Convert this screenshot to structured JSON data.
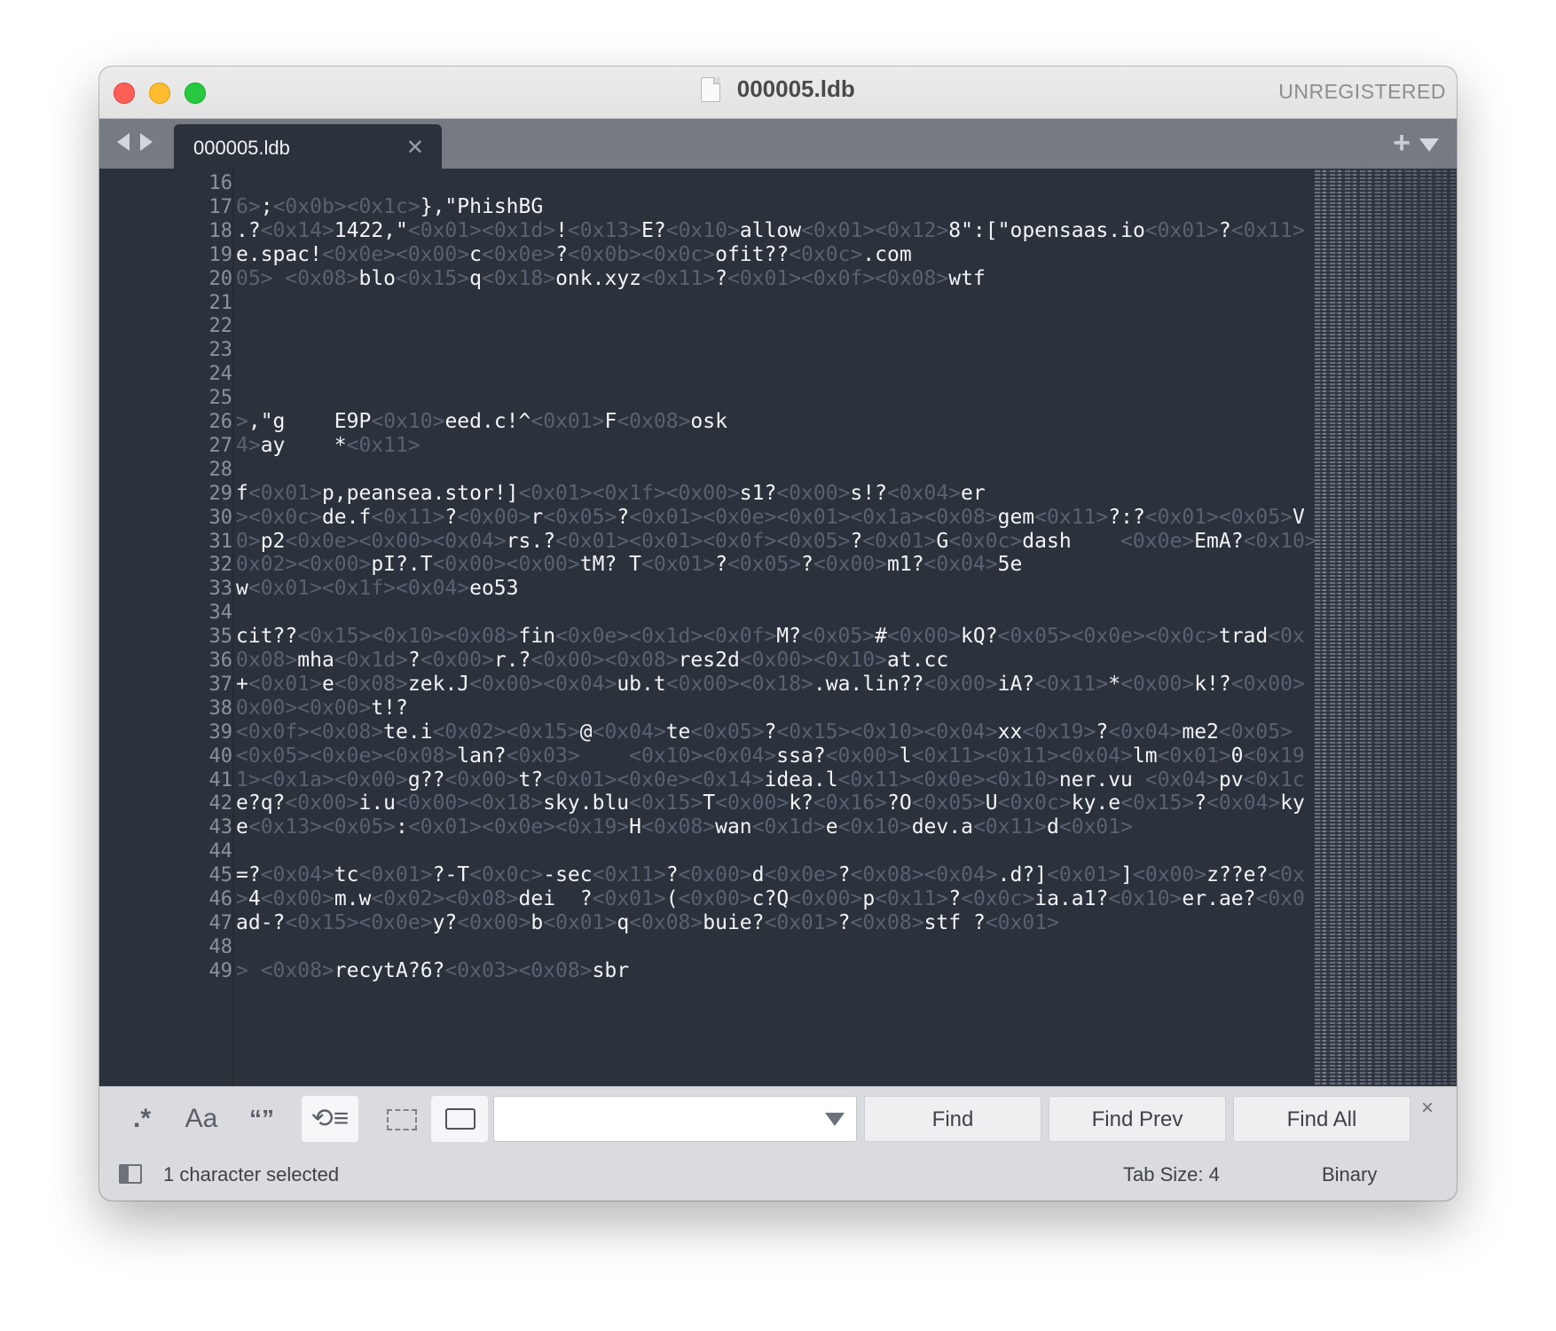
{
  "window": {
    "title": "000005.ldb",
    "unregistered": "UNREGISTERED",
    "traffic_lights": [
      "close",
      "minimize",
      "zoom"
    ]
  },
  "tabs": [
    {
      "label": "000005.ldb",
      "active": true
    }
  ],
  "editor": {
    "colors": {
      "background": "#2c323b",
      "text": "#f2f4f7",
      "control_chars": "#596270",
      "line_numbers": "#8a929c"
    },
    "first_line_number": 16,
    "lines": [
      [],
      [
        [
          "c",
          "6>"
        ],
        [
          "t",
          ";"
        ],
        [
          "c",
          "<0x0b><0x1c>"
        ],
        [
          "t",
          "},\"PhishBG"
        ]
      ],
      [
        [
          "t",
          ".?"
        ],
        [
          "c",
          "<0x14>"
        ],
        [
          "t",
          "1422,\""
        ],
        [
          "c",
          "<0x01><0x1d>"
        ],
        [
          "t",
          "!"
        ],
        [
          "c",
          "<0x13>"
        ],
        [
          "t",
          "E?"
        ],
        [
          "c",
          "<0x10>"
        ],
        [
          "t",
          "allow"
        ],
        [
          "c",
          "<0x01><0x12>"
        ],
        [
          "t",
          "8\":[\"opensaas.io"
        ],
        [
          "c",
          "<0x01>"
        ],
        [
          "t",
          "?"
        ],
        [
          "c",
          "<0x11>"
        ]
      ],
      [
        [
          "t",
          "e.spac!"
        ],
        [
          "c",
          "<0x0e><0x00>"
        ],
        [
          "t",
          "c"
        ],
        [
          "c",
          "<0x0e>"
        ],
        [
          "t",
          "?"
        ],
        [
          "c",
          "<0x0b><0x0c>"
        ],
        [
          "t",
          "ofit??"
        ],
        [
          "c",
          "<0x0c>"
        ],
        [
          "t",
          ".com"
        ]
      ],
      [
        [
          "c",
          "05> <0x08>"
        ],
        [
          "t",
          "blo"
        ],
        [
          "c",
          "<0x15>"
        ],
        [
          "t",
          "q"
        ],
        [
          "c",
          "<0x18>"
        ],
        [
          "t",
          "onk.xyz"
        ],
        [
          "c",
          "<0x11>"
        ],
        [
          "t",
          "?"
        ],
        [
          "c",
          "<0x01><0x0f><0x08>"
        ],
        [
          "t",
          "wtf"
        ]
      ],
      [],
      [],
      [],
      [],
      [],
      [
        [
          "c",
          ">"
        ],
        [
          "t",
          ",\"g    E9P"
        ],
        [
          "c",
          "<0x10>"
        ],
        [
          "t",
          "eed.c!^"
        ],
        [
          "c",
          "<0x01>"
        ],
        [
          "t",
          "F"
        ],
        [
          "c",
          "<0x08>"
        ],
        [
          "t",
          "osk"
        ]
      ],
      [
        [
          "c",
          "4>"
        ],
        [
          "t",
          "ay    *"
        ],
        [
          "c",
          "<0x11>"
        ]
      ],
      [],
      [
        [
          "t",
          "f"
        ],
        [
          "c",
          "<0x01>"
        ],
        [
          "t",
          "p,peansea.stor!]"
        ],
        [
          "c",
          "<0x01><0x1f><0x00>"
        ],
        [
          "t",
          "s1?"
        ],
        [
          "c",
          "<0x00>"
        ],
        [
          "t",
          "s!?"
        ],
        [
          "c",
          "<0x04>"
        ],
        [
          "t",
          "er"
        ]
      ],
      [
        [
          "c",
          "><0x0c>"
        ],
        [
          "t",
          "de.f"
        ],
        [
          "c",
          "<0x11>"
        ],
        [
          "t",
          "?"
        ],
        [
          "c",
          "<0x00>"
        ],
        [
          "t",
          "r"
        ],
        [
          "c",
          "<0x05>"
        ],
        [
          "t",
          "?"
        ],
        [
          "c",
          "<0x01><0x0e><0x01><0x1a><0x08>"
        ],
        [
          "t",
          "gem"
        ],
        [
          "c",
          "<0x11>"
        ],
        [
          "t",
          "?:?"
        ],
        [
          "c",
          "<0x01><0x05>"
        ],
        [
          "t",
          "V"
        ]
      ],
      [
        [
          "c",
          "0>"
        ],
        [
          "t",
          "p2"
        ],
        [
          "c",
          "<0x0e><0x00><0x04>"
        ],
        [
          "t",
          "rs.?"
        ],
        [
          "c",
          "<0x01><0x01><0x0f><0x05>"
        ],
        [
          "t",
          "?"
        ],
        [
          "c",
          "<0x01>"
        ],
        [
          "t",
          "G"
        ],
        [
          "c",
          "<0x0c>"
        ],
        [
          "t",
          "dash    "
        ],
        [
          "c",
          "<0x0e>"
        ],
        [
          "t",
          "EmA?"
        ],
        [
          "c",
          "<0x10>"
        ]
      ],
      [
        [
          "c",
          "0x02><0x00>"
        ],
        [
          "t",
          "pI?.T"
        ],
        [
          "c",
          "<0x00><0x00>"
        ],
        [
          "t",
          "tM? T"
        ],
        [
          "c",
          "<0x01>"
        ],
        [
          "t",
          "?"
        ],
        [
          "c",
          "<0x05>"
        ],
        [
          "t",
          "?"
        ],
        [
          "c",
          "<0x00>"
        ],
        [
          "t",
          "m1?"
        ],
        [
          "c",
          "<0x04>"
        ],
        [
          "t",
          "5e"
        ]
      ],
      [
        [
          "t",
          "w"
        ],
        [
          "c",
          "<0x01><0x1f><0x04>"
        ],
        [
          "t",
          "eo53"
        ]
      ],
      [],
      [
        [
          "t",
          "cit??"
        ],
        [
          "c",
          "<0x15><0x10><0x08>"
        ],
        [
          "t",
          "fin"
        ],
        [
          "c",
          "<0x0e><0x1d><0x0f>"
        ],
        [
          "t",
          "M?"
        ],
        [
          "c",
          "<0x05>"
        ],
        [
          "t",
          "#"
        ],
        [
          "c",
          "<0x00>"
        ],
        [
          "t",
          "kQ?"
        ],
        [
          "c",
          "<0x05><0x0e><0x0c>"
        ],
        [
          "t",
          "trad"
        ],
        [
          "c",
          "<0x"
        ]
      ],
      [
        [
          "c",
          "0x08>"
        ],
        [
          "t",
          "mha"
        ],
        [
          "c",
          "<0x1d>"
        ],
        [
          "t",
          "?"
        ],
        [
          "c",
          "<0x00>"
        ],
        [
          "t",
          "r.?"
        ],
        [
          "c",
          "<0x00><0x08>"
        ],
        [
          "t",
          "res2d"
        ],
        [
          "c",
          "<0x00><0x10>"
        ],
        [
          "t",
          "at.cc"
        ]
      ],
      [
        [
          "t",
          "+"
        ],
        [
          "c",
          "<0x01>"
        ],
        [
          "t",
          "e"
        ],
        [
          "c",
          "<0x08>"
        ],
        [
          "t",
          "zek.J"
        ],
        [
          "c",
          "<0x00><0x04>"
        ],
        [
          "t",
          "ub.t"
        ],
        [
          "c",
          "<0x00><0x18>"
        ],
        [
          "t",
          ".wa.lin??"
        ],
        [
          "c",
          "<0x00>"
        ],
        [
          "t",
          "iA?"
        ],
        [
          "c",
          "<0x11>"
        ],
        [
          "t",
          "*"
        ],
        [
          "c",
          "<0x00>"
        ],
        [
          "t",
          "k!?"
        ],
        [
          "c",
          "<0x00>"
        ]
      ],
      [
        [
          "c",
          "0x00><0x00>"
        ],
        [
          "t",
          "t!?"
        ]
      ],
      [
        [
          "c",
          "<0x0f><0x08>"
        ],
        [
          "t",
          "te.i"
        ],
        [
          "c",
          "<0x02><0x15>"
        ],
        [
          "t",
          "@"
        ],
        [
          "c",
          "<0x04>"
        ],
        [
          "t",
          "te"
        ],
        [
          "c",
          "<0x05>"
        ],
        [
          "t",
          "?"
        ],
        [
          "c",
          "<0x15><0x10><0x04>"
        ],
        [
          "t",
          "xx"
        ],
        [
          "c",
          "<0x19>"
        ],
        [
          "t",
          "?"
        ],
        [
          "c",
          "<0x04>"
        ],
        [
          "t",
          "me2"
        ],
        [
          "c",
          "<0x05>"
        ]
      ],
      [
        [
          "c",
          "<0x05><0x0e><0x08>"
        ],
        [
          "t",
          "lan?"
        ],
        [
          "c",
          "<0x03>    <0x10><0x04>"
        ],
        [
          "t",
          "ssa?"
        ],
        [
          "c",
          "<0x00>"
        ],
        [
          "t",
          "l"
        ],
        [
          "c",
          "<0x11><0x11><0x04>"
        ],
        [
          "t",
          "lm"
        ],
        [
          "c",
          "<0x01>"
        ],
        [
          "t",
          "0"
        ],
        [
          "c",
          "<0x19"
        ]
      ],
      [
        [
          "c",
          "1><0x1a><0x00>"
        ],
        [
          "t",
          "g??"
        ],
        [
          "c",
          "<0x00>"
        ],
        [
          "t",
          "t?"
        ],
        [
          "c",
          "<0x01><0x0e><0x14>"
        ],
        [
          "t",
          "idea.l"
        ],
        [
          "c",
          "<0x11><0x0e><0x10>"
        ],
        [
          "t",
          "ner.vu "
        ],
        [
          "c",
          "<0x04>"
        ],
        [
          "t",
          "pv"
        ],
        [
          "c",
          "<0x1c"
        ]
      ],
      [
        [
          "t",
          "e?q?"
        ],
        [
          "c",
          "<0x00>"
        ],
        [
          "t",
          "i.u"
        ],
        [
          "c",
          "<0x00><0x18>"
        ],
        [
          "t",
          "sky.blu"
        ],
        [
          "c",
          "<0x15>"
        ],
        [
          "t",
          "T"
        ],
        [
          "c",
          "<0x00>"
        ],
        [
          "t",
          "k?"
        ],
        [
          "c",
          "<0x16>"
        ],
        [
          "t",
          "?O"
        ],
        [
          "c",
          "<0x05>"
        ],
        [
          "t",
          "U"
        ],
        [
          "c",
          "<0x0c>"
        ],
        [
          "t",
          "ky.e"
        ],
        [
          "c",
          "<0x15>"
        ],
        [
          "t",
          "?"
        ],
        [
          "c",
          "<0x04>"
        ],
        [
          "t",
          "ky"
        ]
      ],
      [
        [
          "t",
          "e"
        ],
        [
          "c",
          "<0x13><0x05>"
        ],
        [
          "t",
          ":"
        ],
        [
          "c",
          "<0x01><0x0e><0x19>"
        ],
        [
          "t",
          "H"
        ],
        [
          "c",
          "<0x08>"
        ],
        [
          "t",
          "wan"
        ],
        [
          "c",
          "<0x1d>"
        ],
        [
          "t",
          "e"
        ],
        [
          "c",
          "<0x10>"
        ],
        [
          "t",
          "dev.a"
        ],
        [
          "c",
          "<0x11>"
        ],
        [
          "t",
          "d"
        ],
        [
          "c",
          "<0x01>"
        ]
      ],
      [],
      [
        [
          "t",
          "=?"
        ],
        [
          "c",
          "<0x04>"
        ],
        [
          "t",
          "tc"
        ],
        [
          "c",
          "<0x01>"
        ],
        [
          "t",
          "?-T"
        ],
        [
          "c",
          "<0x0c>"
        ],
        [
          "t",
          "-sec"
        ],
        [
          "c",
          "<0x11>"
        ],
        [
          "t",
          "?"
        ],
        [
          "c",
          "<0x00>"
        ],
        [
          "t",
          "d"
        ],
        [
          "c",
          "<0x0e>"
        ],
        [
          "t",
          "?"
        ],
        [
          "c",
          "<0x08><0x04>"
        ],
        [
          "t",
          ".d?]"
        ],
        [
          "c",
          "<0x01>"
        ],
        [
          "t",
          "]"
        ],
        [
          "c",
          "<0x00>"
        ],
        [
          "t",
          "z??e?"
        ],
        [
          "c",
          "<0x"
        ]
      ],
      [
        [
          "c",
          ">"
        ],
        [
          "t",
          "4"
        ],
        [
          "c",
          "<0x00>"
        ],
        [
          "t",
          "m.w"
        ],
        [
          "c",
          "<0x02><0x08>"
        ],
        [
          "t",
          "dei  ?"
        ],
        [
          "c",
          "<0x01>"
        ],
        [
          "t",
          "("
        ],
        [
          "c",
          "<0x00>"
        ],
        [
          "t",
          "c?Q"
        ],
        [
          "c",
          "<0x00>"
        ],
        [
          "t",
          "p"
        ],
        [
          "c",
          "<0x11>"
        ],
        [
          "t",
          "?"
        ],
        [
          "c",
          "<0x0c>"
        ],
        [
          "t",
          "ia.a1?"
        ],
        [
          "c",
          "<0x10>"
        ],
        [
          "t",
          "er.ae?"
        ],
        [
          "c",
          "<0x0"
        ]
      ],
      [
        [
          "t",
          "ad-?"
        ],
        [
          "c",
          "<0x15><0x0e>"
        ],
        [
          "t",
          "y?"
        ],
        [
          "c",
          "<0x00>"
        ],
        [
          "t",
          "b"
        ],
        [
          "c",
          "<0x01>"
        ],
        [
          "t",
          "q"
        ],
        [
          "c",
          "<0x08>"
        ],
        [
          "t",
          "buie?"
        ],
        [
          "c",
          "<0x01>"
        ],
        [
          "t",
          "?"
        ],
        [
          "c",
          "<0x08>"
        ],
        [
          "t",
          "stf ?"
        ],
        [
          "c",
          "<0x01>"
        ]
      ],
      [],
      [
        [
          "c",
          "> <0x08>"
        ],
        [
          "t",
          "recytA?6?"
        ],
        [
          "c",
          "<0x03><0x08>"
        ],
        [
          "t",
          "sbr"
        ]
      ]
    ]
  },
  "find_panel": {
    "toggles": [
      {
        "name": "regex",
        "glyph": ".*",
        "active": false
      },
      {
        "name": "case",
        "glyph": "Aa",
        "active": false
      },
      {
        "name": "whole-word",
        "glyph": "“”",
        "active": false
      },
      {
        "name": "wrap",
        "glyph": "⟲≡",
        "active": true
      },
      {
        "name": "in-selection",
        "glyph": "",
        "active": false
      },
      {
        "name": "highlight",
        "glyph": "",
        "active": true
      }
    ],
    "search_value": "",
    "buttons": {
      "find": "Find",
      "find_prev": "Find Prev",
      "find_all": "Find All"
    },
    "close": "×"
  },
  "status_bar": {
    "selection": "1 character selected",
    "tab_size": "Tab Size: 4",
    "syntax": "Binary"
  }
}
